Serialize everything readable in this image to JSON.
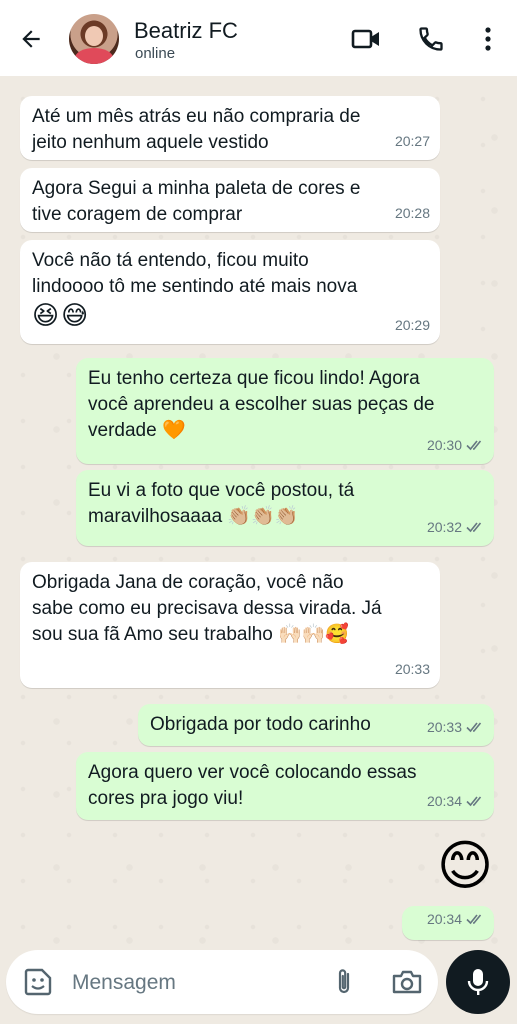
{
  "header": {
    "contact_name": "Beatriz FC",
    "status": "online"
  },
  "messages": [
    {
      "direction": "in",
      "text": "Até um mês atrás eu não compraria de\njeito nenhum aquele vestido",
      "emoji": "",
      "time": "20:27"
    },
    {
      "direction": "in",
      "text": "Agora Segui a minha paleta de cores e\ntive coragem de comprar",
      "emoji": "",
      "time": "20:28"
    },
    {
      "direction": "in",
      "text": "Você não tá entendo, ficou muito\nlindoooo tô me sentindo até mais nova",
      "emoji": "😆😅",
      "time": "20:29"
    },
    {
      "direction": "out",
      "text": "Eu tenho certeza que ficou lindo! Agora\nvocê aprendeu a escolher suas peças de\nverdade 🧡",
      "emoji": "",
      "time": "20:30"
    },
    {
      "direction": "out",
      "text": "Eu vi a foto que você postou, tá\nmaravilhosaaaa 👏🏼👏🏼👏🏼",
      "emoji": "",
      "time": "20:32"
    },
    {
      "direction": "in",
      "text": "Obrigada Jana de coração, você não\nsabe como eu precisava dessa virada. Já\nsou sua fã Amo seu trabalho 🙌🏻🙌🏻🥰",
      "emoji": "",
      "time": "20:33"
    },
    {
      "direction": "out",
      "text": "Obrigada por todo carinho",
      "emoji": "",
      "time": "20:33"
    },
    {
      "direction": "out",
      "text": "Agora quero ver você colocando essas\ncores pra jogo viu!",
      "emoji": "",
      "time": "20:34"
    },
    {
      "direction": "out",
      "text": "",
      "emoji": "😊",
      "time": "20:34"
    }
  ],
  "input": {
    "placeholder": "Mensagem",
    "value": ""
  },
  "icons": {
    "back": "arrow-left-icon",
    "video": "video-camera-icon",
    "call": "phone-icon",
    "menu": "more-vertical-icon",
    "sticker": "sticker-icon",
    "attach": "paperclip-icon",
    "camera": "camera-icon",
    "mic": "microphone-icon"
  },
  "colors": {
    "chat_background": "#efeae2",
    "incoming_bubble": "#ffffff",
    "outgoing_bubble": "#d9fdd3",
    "read_ticks": "#667781",
    "mic_button": "#111b21"
  }
}
